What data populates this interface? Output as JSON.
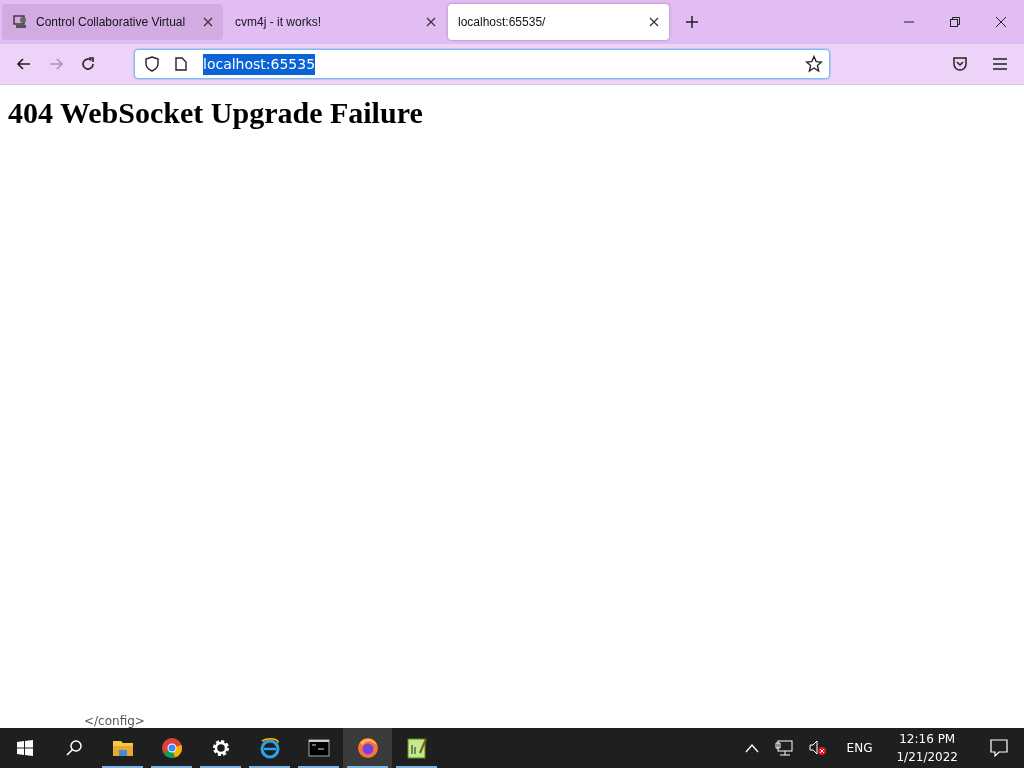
{
  "tabs": [
    {
      "title": "Control Collaborative Virtual",
      "selected": false,
      "hovered": true,
      "icon": true
    },
    {
      "title": "cvm4j - it works!",
      "selected": false,
      "hovered": false,
      "icon": false
    },
    {
      "title": "localhost:65535/",
      "selected": true,
      "hovered": false,
      "icon": false
    }
  ],
  "address_bar": {
    "value": "localhost:65535",
    "selected_text": true
  },
  "page": {
    "heading": "404 WebSocket Upgrade Failure"
  },
  "ghost_text": "</config>",
  "taskbar": {
    "apps": [
      {
        "kind": "explorer",
        "selected": false
      },
      {
        "kind": "chrome",
        "selected": false
      },
      {
        "kind": "settings",
        "selected": false
      },
      {
        "kind": "ie",
        "selected": false
      },
      {
        "kind": "terminal",
        "selected": false
      },
      {
        "kind": "firefox",
        "selected": true
      },
      {
        "kind": "notepad",
        "selected": false
      }
    ],
    "language": "ENG",
    "time": "12:16 PM",
    "date": "1/21/2022"
  }
}
